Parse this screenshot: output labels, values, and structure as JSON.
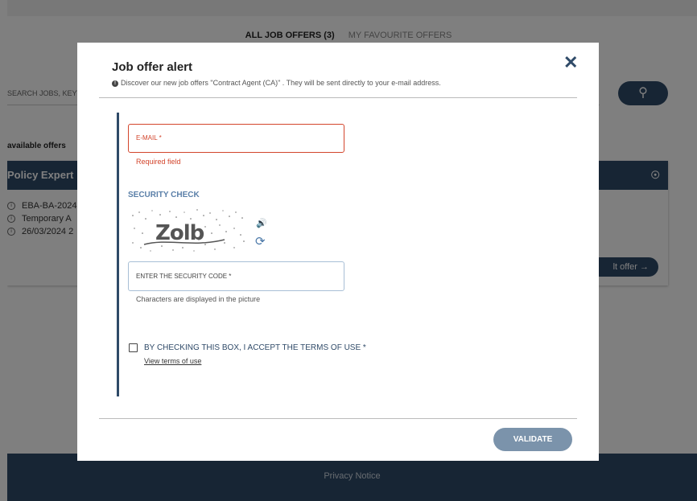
{
  "tabs": {
    "all": "ALL JOB OFFERS (3)",
    "favourites": "MY FAVOURITE OFFERS"
  },
  "search": {
    "placeholder": "SEARCH JOBS, KEYW"
  },
  "results": {
    "label": "available offers",
    "card": {
      "title": "Policy Expert",
      "lines": [
        "EBA-BA-2024",
        "Temporary A",
        "26/03/2024 2"
      ],
      "consult_label": "lt offer →"
    }
  },
  "footer": {
    "privacy": "Privacy Notice"
  },
  "modal": {
    "title": "Job offer alert",
    "subtitle": "Discover our new job offers \"Contract Agent (CA)\" . They will be sent directly to your e-mail address.",
    "close_symbol": "✕",
    "email": {
      "label": "E-MAIL *",
      "error": "Required field"
    },
    "security": {
      "title": "SECURITY CHECK",
      "captcha_text": "Zolb",
      "code_label": "ENTER THE SECURITY CODE *",
      "code_hint": "Characters are displayed in the picture"
    },
    "terms": {
      "label": "BY CHECKING THIS BOX, I ACCEPT THE TERMS OF USE *",
      "link": "View terms of use"
    },
    "validate": "VALIDATE"
  },
  "icons": {
    "audio": "speaker-icon",
    "refresh": "refresh-icon",
    "search": "search-icon",
    "pin": "pin-icon",
    "info": "info-icon",
    "close": "close-icon"
  },
  "colors": {
    "primary": "#2f4a68",
    "error": "#d3452c",
    "accent": "#5a7fa8",
    "button": "#7b93ab"
  }
}
